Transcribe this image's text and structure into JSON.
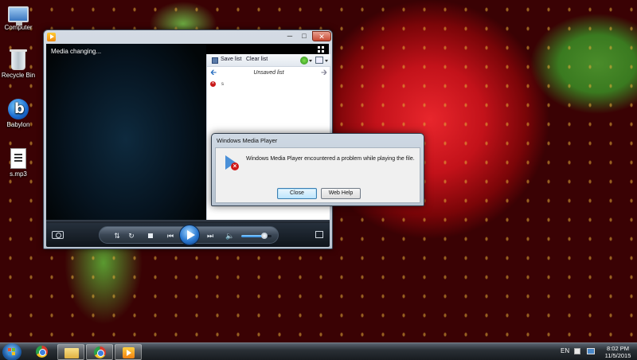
{
  "desktop": {
    "icons": [
      {
        "label": "Computer",
        "icon": "computer-icon"
      },
      {
        "label": "Recycle Bin",
        "icon": "recycle-bin-icon"
      },
      {
        "label": "Babylon",
        "icon": "babylon-icon"
      },
      {
        "label": "s.mp3",
        "icon": "audio-file-icon"
      }
    ]
  },
  "wmp": {
    "title": "",
    "status_text": "Media changing...",
    "list_toolbar": {
      "save_label": "Save list",
      "clear_label": "Clear list"
    },
    "list_title": "Unsaved list",
    "playlist_items": [
      {
        "title": "s",
        "status": "error"
      }
    ],
    "controls": {
      "volume_level": 0.75
    }
  },
  "dialog": {
    "title": "Windows Media Player",
    "message": "Windows Media Player encountered a problem while playing the file.",
    "close_label": "Close",
    "webhelp_label": "Web Help"
  },
  "taskbar": {
    "items": [
      "chrome",
      "windows-explorer",
      "chrome",
      "windows-media-player"
    ],
    "language": "EN",
    "time": "8:02 PM",
    "date": "11/5/2015"
  },
  "colors": {
    "accent": "#2a78d0",
    "error": "#d01818"
  }
}
